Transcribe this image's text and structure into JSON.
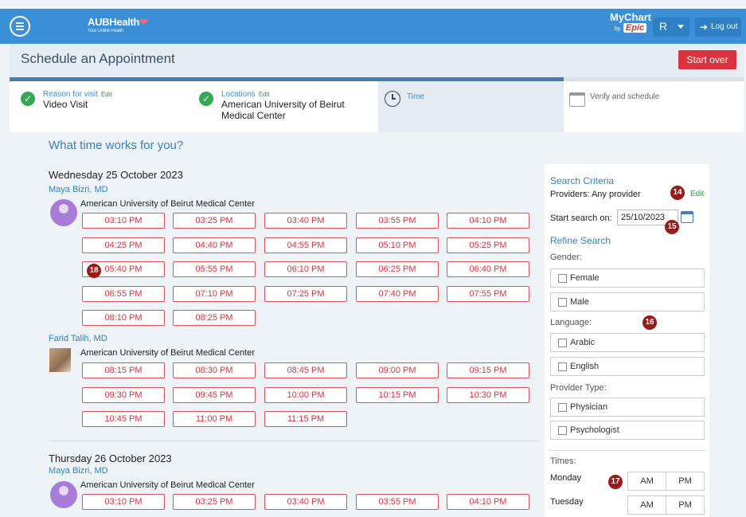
{
  "topbar": {
    "brand_main": "AUBHealth",
    "brand_tagline": "Your Online Health",
    "mychart_label": "MyChart",
    "mychart_by": "by",
    "mychart_epic": "Epic",
    "user_initial": "R",
    "logout_label": "Log out"
  },
  "page": {
    "title": "Schedule an Appointment",
    "start_over": "Start over"
  },
  "steps": [
    {
      "label": "Reason for visit",
      "edit": "Edit",
      "value": "Video Visit"
    },
    {
      "label": "Locations",
      "edit": "Edit",
      "value_line1": "American University of Beirut",
      "value_line2": "Medical Center"
    },
    {
      "label": "Time"
    },
    {
      "label": "Verify and schedule"
    }
  ],
  "question": "What time works for you?",
  "days": [
    {
      "date": "Wednesday 25 October 2023",
      "providers": [
        {
          "name": "Maya Bizri, MD",
          "facility": "American University of Beirut Medical Center",
          "slots": [
            "03:10 PM",
            "03:25 PM",
            "03:40 PM",
            "03:55 PM",
            "04:10 PM",
            "04:25 PM",
            "04:40 PM",
            "04:55 PM",
            "05:10 PM",
            "05:25 PM",
            "05:40 PM",
            "05:55 PM",
            "06:10 PM",
            "06:25 PM",
            "06:40 PM",
            "06:55 PM",
            "07:10 PM",
            "07:25 PM",
            "07:40 PM",
            "07:55 PM",
            "08:10 PM",
            "08:25 PM"
          ]
        },
        {
          "name": "Farid Talih, MD",
          "facility": "American University of Beirut Medical Center",
          "slots": [
            "08:15 PM",
            "08:30 PM",
            "08:45 PM",
            "09:00 PM",
            "09:15 PM",
            "09:30 PM",
            "09:45 PM",
            "10:00 PM",
            "10:15 PM",
            "10:30 PM",
            "10:45 PM",
            "11:00 PM",
            "11:15 PM"
          ]
        }
      ]
    },
    {
      "date": "Thursday 26 October 2023",
      "providers": [
        {
          "name": "Maya Bizri, MD",
          "facility": "American University of Beirut Medical Center",
          "slots": [
            "03:10 PM",
            "03:25 PM",
            "03:40 PM",
            "03:55 PM",
            "04:10 PM"
          ]
        }
      ]
    }
  ],
  "sidebar": {
    "title": "Search Criteria",
    "providers_text": "Providers: Any provider",
    "edit": "Edit",
    "start_search_label": "Start search on:",
    "start_search_value": "25/10/2023",
    "refine_title": "Refine Search",
    "gender_label": "Gender:",
    "gender_options": [
      "Female",
      "Male"
    ],
    "language_label": "Language:",
    "language_options": [
      "Arabic",
      "English"
    ],
    "provider_type_label": "Provider Type:",
    "provider_type_options": [
      "Physician",
      "Psychologist"
    ],
    "times_label": "Times:",
    "days": [
      {
        "day": "Monday",
        "am": "AM",
        "pm": "PM"
      },
      {
        "day": "Tuesday",
        "am": "AM",
        "pm": "PM"
      }
    ]
  },
  "markers": [
    "14",
    "15",
    "16",
    "17",
    "18"
  ],
  "colors": {
    "header": "#3a8fd6",
    "slot_border": "#e0525a",
    "start_over": "#d9333f",
    "link": "#3a7fc0",
    "check": "#34a853",
    "marker": "#9a1a1a"
  }
}
